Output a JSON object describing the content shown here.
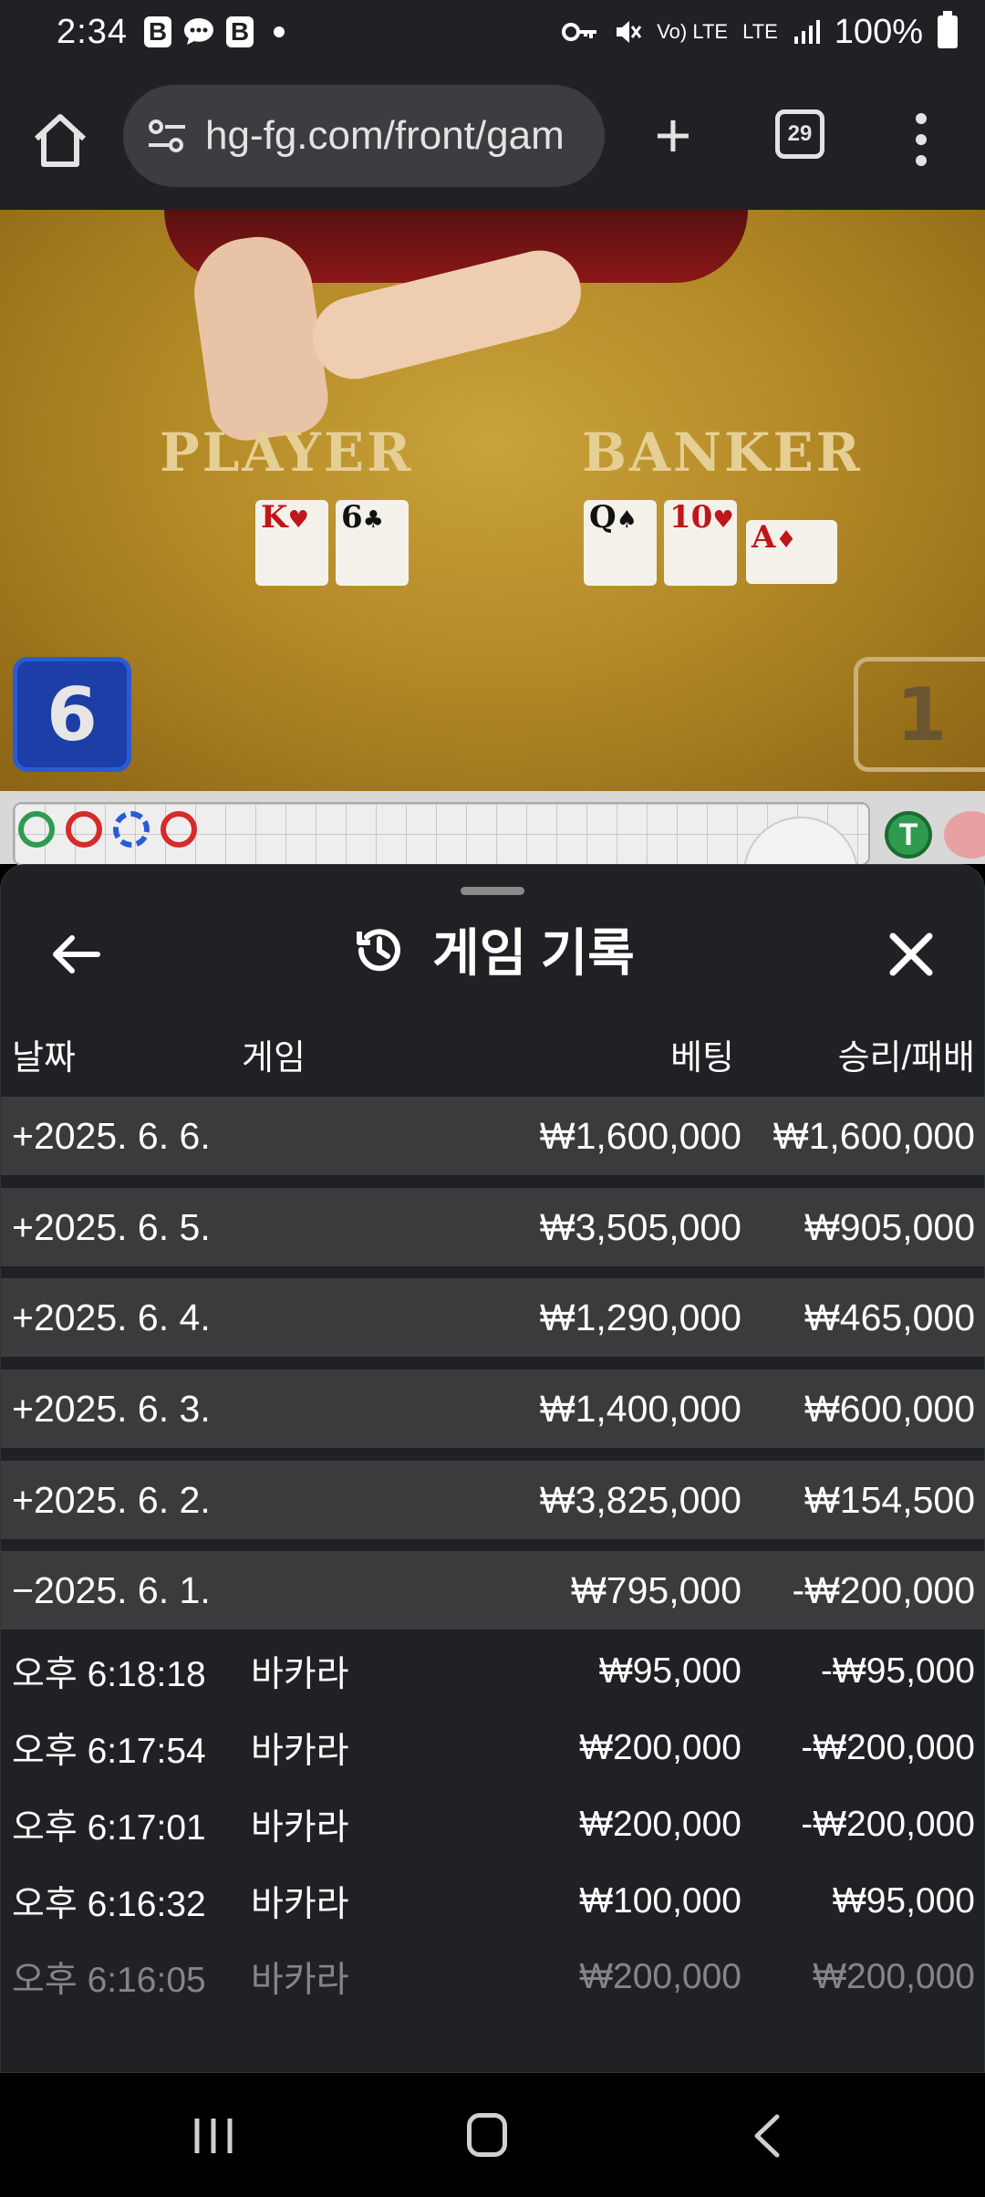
{
  "status_bar": {
    "time": "2:34",
    "badges": [
      "B",
      "chat-bubble-icon",
      "B"
    ],
    "network": "LTE",
    "volte": "Vo) LTE",
    "battery": "100%"
  },
  "browser": {
    "url": "hg-fg.com/front/gam",
    "tab_count": "29",
    "new_tab_label": "+"
  },
  "game_view": {
    "player_label": "PLAYER",
    "banker_label": "BANKER",
    "player_cards": [
      {
        "rank": "K",
        "suit": "♥",
        "color": "red"
      },
      {
        "rank": "6",
        "suit": "♣",
        "color": "black"
      }
    ],
    "banker_cards": [
      {
        "rank": "Q",
        "suit": "♠",
        "color": "black"
      },
      {
        "rank": "10",
        "suit": "♥",
        "color": "red"
      },
      {
        "rank": "A",
        "suit": "♦",
        "color": "red"
      }
    ],
    "player_score": "6",
    "banker_score": "1",
    "road_tie_label": "T"
  },
  "sheet": {
    "title": "게임 기록",
    "columns": {
      "date": "날짜",
      "game": "게임",
      "bet": "베팅",
      "result": "승리/패배"
    },
    "day_rows": [
      {
        "date": "+2025. 6. 6.",
        "bet": "₩1,600,000",
        "result": "₩1,600,000"
      },
      {
        "date": "+2025. 6. 5.",
        "bet": "₩3,505,000",
        "result": "₩905,000"
      },
      {
        "date": "+2025. 6. 4.",
        "bet": "₩1,290,000",
        "result": "₩465,000"
      },
      {
        "date": "+2025. 6. 3.",
        "bet": "₩1,400,000",
        "result": "₩600,000"
      },
      {
        "date": "+2025. 6. 2.",
        "bet": "₩3,825,000",
        "result": "₩154,500"
      },
      {
        "date": "−2025. 6. 1.",
        "bet": "₩795,000",
        "result": "-₩200,000"
      }
    ],
    "detail_rows": [
      {
        "time": "오후 6:18:18",
        "game": "바카라",
        "bet": "₩95,000",
        "result": "-₩95,000"
      },
      {
        "time": "오후 6:17:54",
        "game": "바카라",
        "bet": "₩200,000",
        "result": "-₩200,000"
      },
      {
        "time": "오후 6:17:01",
        "game": "바카라",
        "bet": "₩200,000",
        "result": "-₩200,000"
      },
      {
        "time": "오후 6:16:32",
        "game": "바카라",
        "bet": "₩100,000",
        "result": "₩95,000"
      },
      {
        "time": "오후 6:16:05",
        "game": "바카라",
        "bet": "₩200,000",
        "result": "₩200,000"
      }
    ]
  }
}
